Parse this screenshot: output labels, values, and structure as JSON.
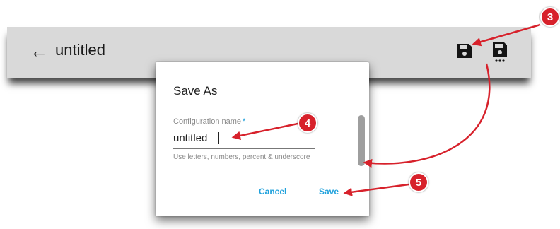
{
  "toolbar": {
    "back_icon": "arrow-left-icon",
    "title": "untitled",
    "save_icon": "floppy-disk-icon",
    "save_as_icon": "floppy-disk-ellipsis-icon"
  },
  "dialog": {
    "title": "Save As",
    "field": {
      "label": "Configuration name",
      "required_mark": "*",
      "value": "untitled",
      "helper": "Use letters, numbers, percent & underscore"
    },
    "buttons": {
      "cancel": "Cancel",
      "save": "Save"
    }
  },
  "callouts": [
    "3",
    "4",
    "5"
  ],
  "colors": {
    "toolbar_bg": "#d9d9d9",
    "accent": "#1fa1dc",
    "callout": "#d7212b"
  }
}
